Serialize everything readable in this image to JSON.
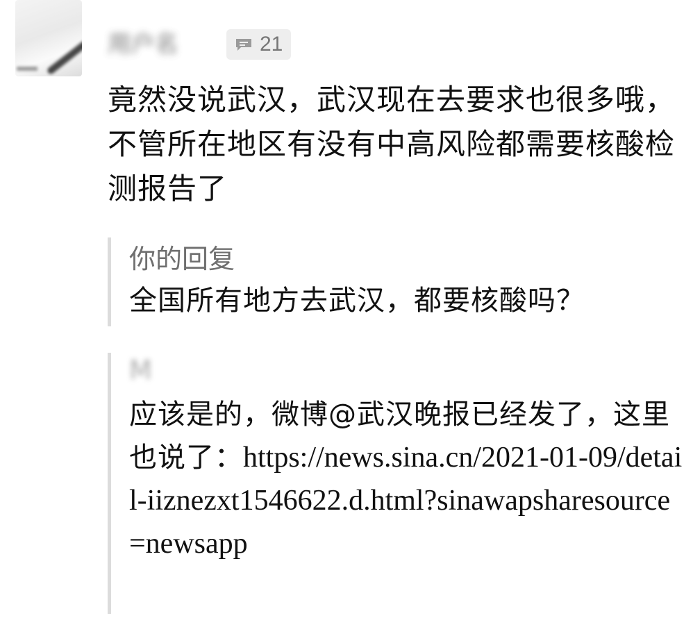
{
  "comment": {
    "author": "用户名",
    "reply_count": "21",
    "text": "竟然没说武汉，武汉现在去要求也很多哦，不管所在地区有没有中高风险都需要核酸检测报告了"
  },
  "quote_reply": {
    "label": "你的回复",
    "text": "全国所有地方去武汉，都要核酸吗？"
  },
  "second_reply": {
    "author": "M",
    "text": "应该是的，微博@武汉晚报已经发了，这里也说了：",
    "link": "https://news.sina.cn/2021-01-09/detail-iiznezxt1546622.d.html?sinawapsharesource=newsapp"
  },
  "icons": {
    "reply_count_icon": "comment-bubble-icon"
  }
}
